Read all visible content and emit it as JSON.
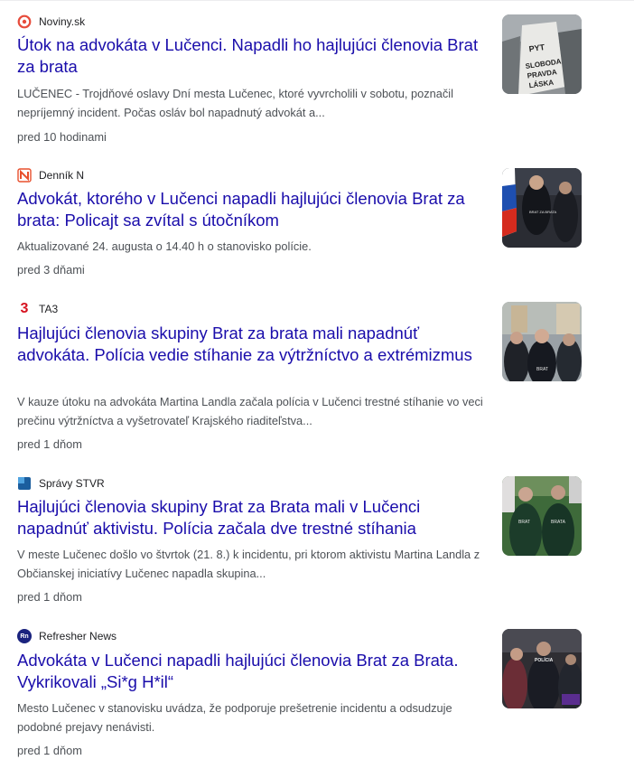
{
  "results": [
    {
      "source": "Noviny.sk",
      "favicon_icon": "noviny-sk-icon",
      "headline": "Útok na advokáta v Lučenci. Napadli ho hajlujúci členovia Brat za brata",
      "snippet": "LUČENEC - Trojdňové oslavy Dní mesta Lučenec, ktoré vyvrcholili v sobotu, poznačil nepríjemný incident. Počas osláv bol napadnutý advokát a...",
      "time": "pred 10 hodinami",
      "thumb_icon": "protest-sign-thumbnail",
      "thumb_text": [
        "PYT",
        "SLOBODA",
        "PRAVDA",
        "LÁSKA"
      ]
    },
    {
      "source": "Denník N",
      "favicon_icon": "dennik-n-icon",
      "headline": "Advokát, ktorého v Lučenci napadli hajlujúci členovia Brat za brata: Policajt sa zvítal s útočníkom",
      "snippet": "Aktualizované 24. augusta o 14.40 h o stanovisko polície.",
      "time": "pred 3 dňami",
      "thumb_icon": "group-with-flag-thumbnail",
      "thumb_text": [
        "BRAT ZA BRATA"
      ]
    },
    {
      "source": "TA3",
      "favicon_icon": "ta3-icon",
      "favicon_glyph": "3",
      "headline": "Hajlujúci členovia skupiny Brat za brata mali napadnúť advokáta. Polícia vedie stíhanie za výtržníctvo a extrémizmus",
      "snippet": "V kauze útoku na advokáta Martina Landla začala polícia v Lučenci trestné stíhanie vo veci prečinu výtržníctva a vyšetrovateľ Krajského riaditeľstva...",
      "time": "pred 1 dňom",
      "thumb_icon": "street-group-thumbnail",
      "thumb_text": [
        "BRAT"
      ]
    },
    {
      "source": "Správy STVR",
      "favicon_icon": "spravy-stvr-icon",
      "headline": "Hajlujúci členovia skupiny Brat za Brata mali v Lučenci napadnúť aktivistu. Polícia začala dve trestné stíhania",
      "snippet": "V meste Lučenec došlo vo štvrtok (21. 8.) k incidentu, pri ktorom aktivistu Martina Landla z Občianskej iniciatívy Lučenec napadla skupina...",
      "time": "pred 1 dňom",
      "thumb_icon": "two-men-backs-thumbnail",
      "thumb_text": [
        "BRAT",
        "BRATA"
      ]
    },
    {
      "source": "Refresher News",
      "favicon_icon": "refresher-news-icon",
      "favicon_glyph": "Rn",
      "headline": "Advokáta v Lučenci napadli hajlujúci členovia Brat za Brata. Vykrikovali „Si*g H*il“",
      "snippet": "Mesto Lučenec v stanovisku uvádza, že podporuje prešetrenie incidentu a odsudzuje podobné prejavy nenávisti.",
      "time": "pred 1 dňom",
      "thumb_icon": "police-officers-thumbnail",
      "thumb_text": [
        "POLÍCIA"
      ]
    }
  ],
  "colors": {
    "headline": "#1a0dab",
    "snippet": "#4d5156",
    "source": "#202124",
    "noviny_accent": "#e74c3c",
    "dennik_accent": "#e8502d",
    "ta3_accent": "#d6121f",
    "stvr_accent": "#1b5e9e",
    "refresher_accent": "#1a237e"
  }
}
